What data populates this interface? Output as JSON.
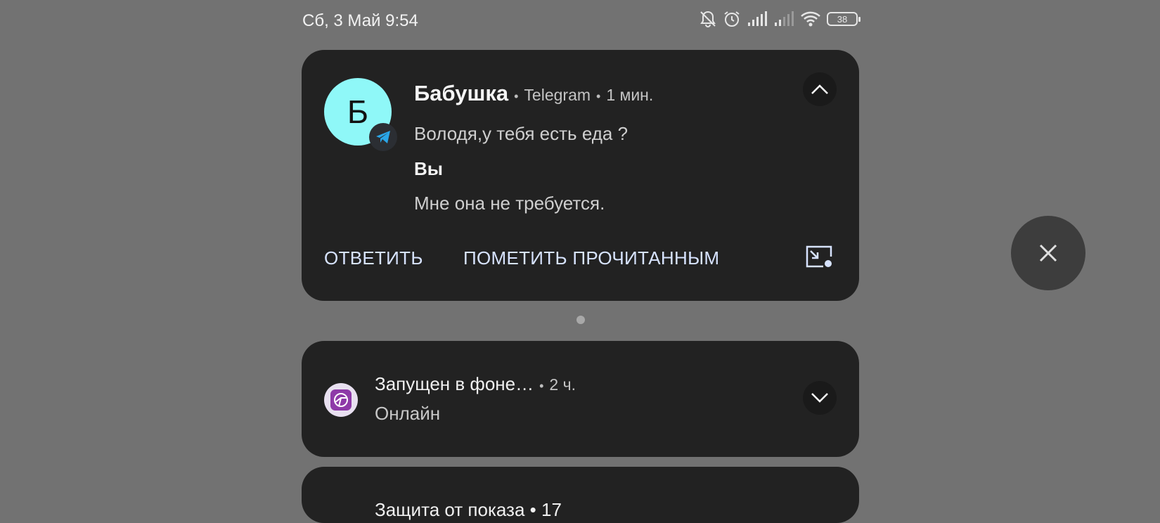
{
  "status_bar": {
    "datetime": "Сб, 3 Май 9:54",
    "battery": "38",
    "icons": [
      "bell-muted-icon",
      "alarm-icon",
      "signal-icon",
      "signal-icon",
      "wifi-icon",
      "battery-icon"
    ]
  },
  "notification": {
    "avatar_letter": "Б",
    "avatar_color": "#8ff8f8",
    "sender": "Бабушка",
    "separator": "•",
    "app": "Telegram",
    "time": "1 мин.",
    "message_1": "Володя,у тебя есть еда ?",
    "you_label": "Вы",
    "message_2": "Мне она не требуется.",
    "actions": {
      "reply": "ОТВЕТИТЬ",
      "mark_read": "ПОМЕТИТЬ ПРОЧИТАННЫМ"
    }
  },
  "background_notification": {
    "title": "Запущен в фоне…",
    "separator": "•",
    "time": "2 ч.",
    "status": "Онлайн"
  },
  "third_notification": {
    "title_partial": "Защита от показа • 17"
  }
}
